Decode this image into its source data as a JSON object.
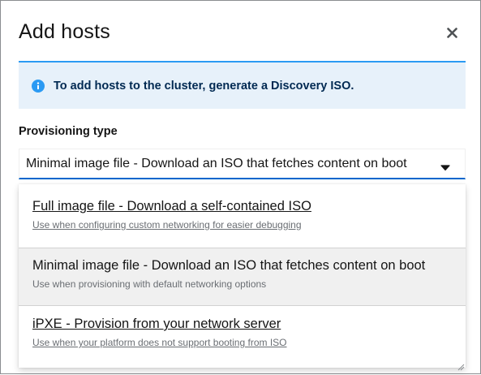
{
  "modal": {
    "title": "Add hosts",
    "close_icon": "close-icon"
  },
  "alert": {
    "icon": "info-circle-icon",
    "text": "To add hosts to the cluster, generate a Discovery ISO.",
    "colors": {
      "background": "#e7f1fa",
      "accent": "#2b9af3",
      "text": "#002952"
    }
  },
  "provisioning": {
    "label": "Provisioning type",
    "selected_value": "Minimal image file - Download an ISO that fetches content on boot",
    "caret_icon": "caret-down-icon",
    "options": [
      {
        "title": "Full image file - Download a self-contained ISO",
        "description": "Use when configuring custom networking for easier debugging"
      },
      {
        "title": "Minimal image file - Download an ISO that fetches content on boot",
        "description": "Use when provisioning with default networking options"
      },
      {
        "title": "iPXE - Provision from your network server",
        "description": "Use when your platform does not support booting from ISO"
      }
    ]
  }
}
